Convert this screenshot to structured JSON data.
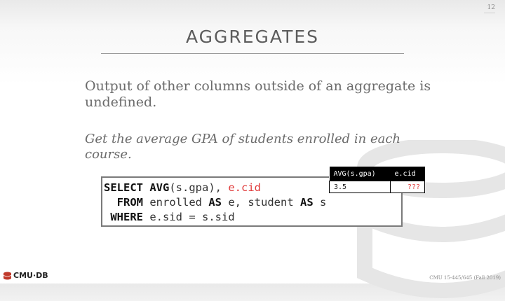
{
  "slide": {
    "page_number": "12",
    "title": "AGGREGATES",
    "body": "Output of other columns outside of an aggregate is undefined.",
    "question": "Get the average GPA of students enrolled in each course."
  },
  "sql": {
    "line1": {
      "kw1": "SELECT",
      "kw2": "AVG",
      "rest": "(s.gpa), ",
      "red": "e.cid"
    },
    "line2": {
      "kw1": "FROM",
      "mid": " enrolled ",
      "kw2": "AS",
      "mid2": " e, student ",
      "kw3": "AS",
      "end": " s"
    },
    "line3": {
      "kw1": "WHERE",
      "rest": " e.sid = s.sid"
    }
  },
  "result": {
    "headers": [
      "AVG(s.gpa)",
      "e.cid"
    ],
    "row": [
      "3.5",
      "???"
    ]
  },
  "footer": {
    "logo_text": "CMU·DB",
    "course": "CMU 15-445/645 (Fall 2019)"
  },
  "colors": {
    "title": "#5c5c5c",
    "body_text": "#6b6b6b",
    "highlight_red": "#e03a3a",
    "header_bg": "#000000"
  }
}
